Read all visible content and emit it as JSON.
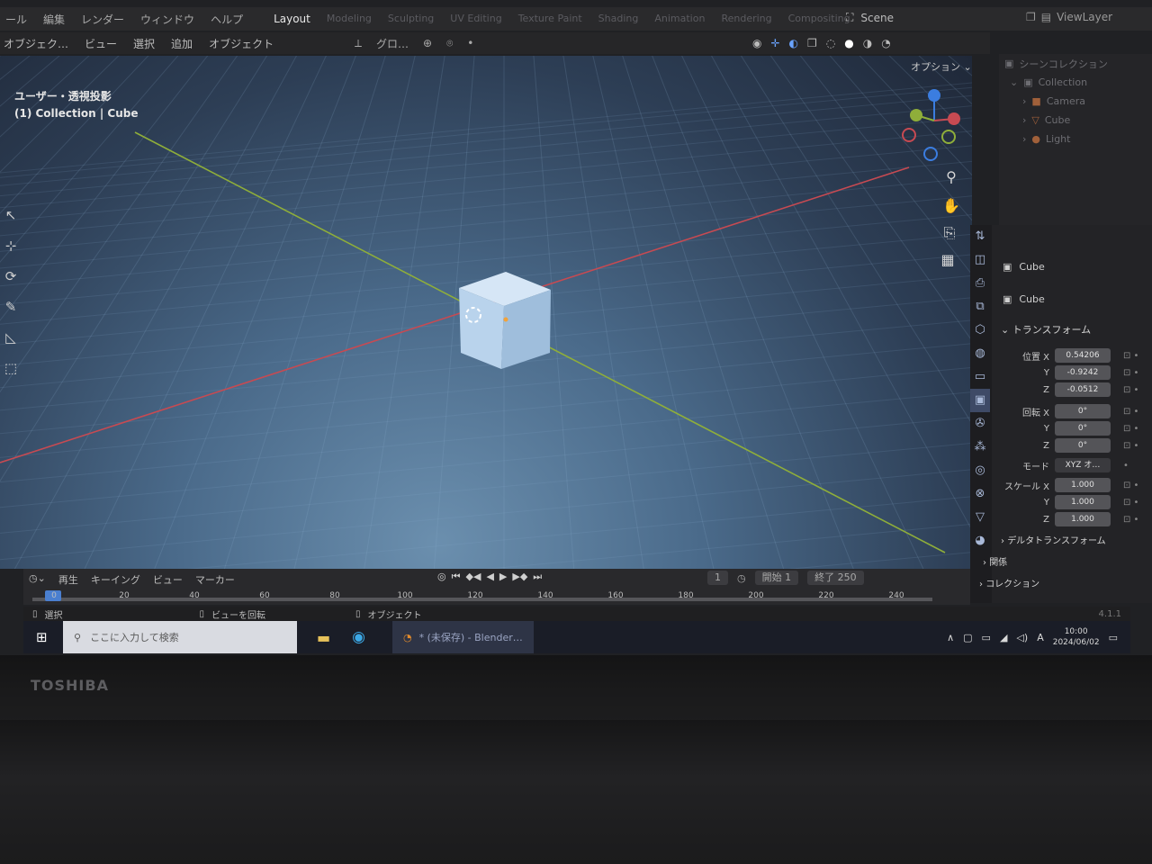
{
  "topbar": {
    "menu": [
      "ール",
      "編集",
      "レンダー",
      "ウィンドウ",
      "ヘルプ"
    ],
    "tabs": [
      {
        "label": "Layout",
        "active": true
      },
      {
        "label": "Modeling",
        "active": false
      },
      {
        "label": "Sculpting",
        "active": false
      },
      {
        "label": "UV Editing",
        "active": false
      },
      {
        "label": "Texture Paint",
        "active": false
      },
      {
        "label": "Shading",
        "active": false
      },
      {
        "label": "Animation",
        "active": false
      },
      {
        "label": "Rendering",
        "active": false
      },
      {
        "label": "Compositing",
        "active": false
      }
    ],
    "scene": "Scene",
    "view_layer": "ViewLayer"
  },
  "header": {
    "left_items": [
      "オブジェク…",
      "ビュー",
      "選択",
      "追加",
      "オブジェクト"
    ],
    "transform_orientation": "グロ…",
    "options": "オプション"
  },
  "viewport": {
    "view_name": "ユーザー・透視投影",
    "collection_line": "(1) Collection | Cube"
  },
  "outliner": {
    "title": "シーンコレクション",
    "collection": "Collection",
    "items": [
      "Camera",
      "Cube",
      "Light"
    ]
  },
  "properties": {
    "object_name": "Cube",
    "data_name": "Cube",
    "transform_header": "トランスフォーム",
    "location_label": "位置 X",
    "rotation_label": "回転 X",
    "scale_label": "スケール X",
    "mode_label": "モード",
    "mode_value": "XYZ オ…",
    "axis_y": "Y",
    "axis_z": "Z",
    "location": [
      "0.54206",
      "-0.9242",
      "-0.0512"
    ],
    "rotation": [
      "0°",
      "0°",
      "0°"
    ],
    "scale": [
      "1.000",
      "1.000",
      "1.000"
    ],
    "delta": "デルタトランスフォーム",
    "relations": "関係",
    "collections": "コレクション"
  },
  "timeline": {
    "menu": [
      "再生",
      "キーイング",
      "ビュー",
      "マーカー"
    ],
    "current_frame": "1",
    "start_label": "開始",
    "start_value": "1",
    "end_label": "終了",
    "end_value": "250",
    "ruler": [
      "0",
      "20",
      "40",
      "60",
      "80",
      "100",
      "120",
      "140",
      "160",
      "180",
      "200",
      "220",
      "240"
    ]
  },
  "status": {
    "select": "選択",
    "rotate": "ビューを回転",
    "object": "オブジェクト",
    "version": "4.1.1"
  },
  "taskbar": {
    "search_placeholder": "ここに入力して検索",
    "app_title": "* (未保存) - Blender…",
    "time": "10:00",
    "date": "2024/06/02",
    "ime": "A"
  },
  "brand": "TOSHIBA",
  "colors": {
    "x_axis": "#c74a52",
    "y_axis": "#8fae3a",
    "cube": "#b9d3ec",
    "accent": "#4a7fd0"
  }
}
